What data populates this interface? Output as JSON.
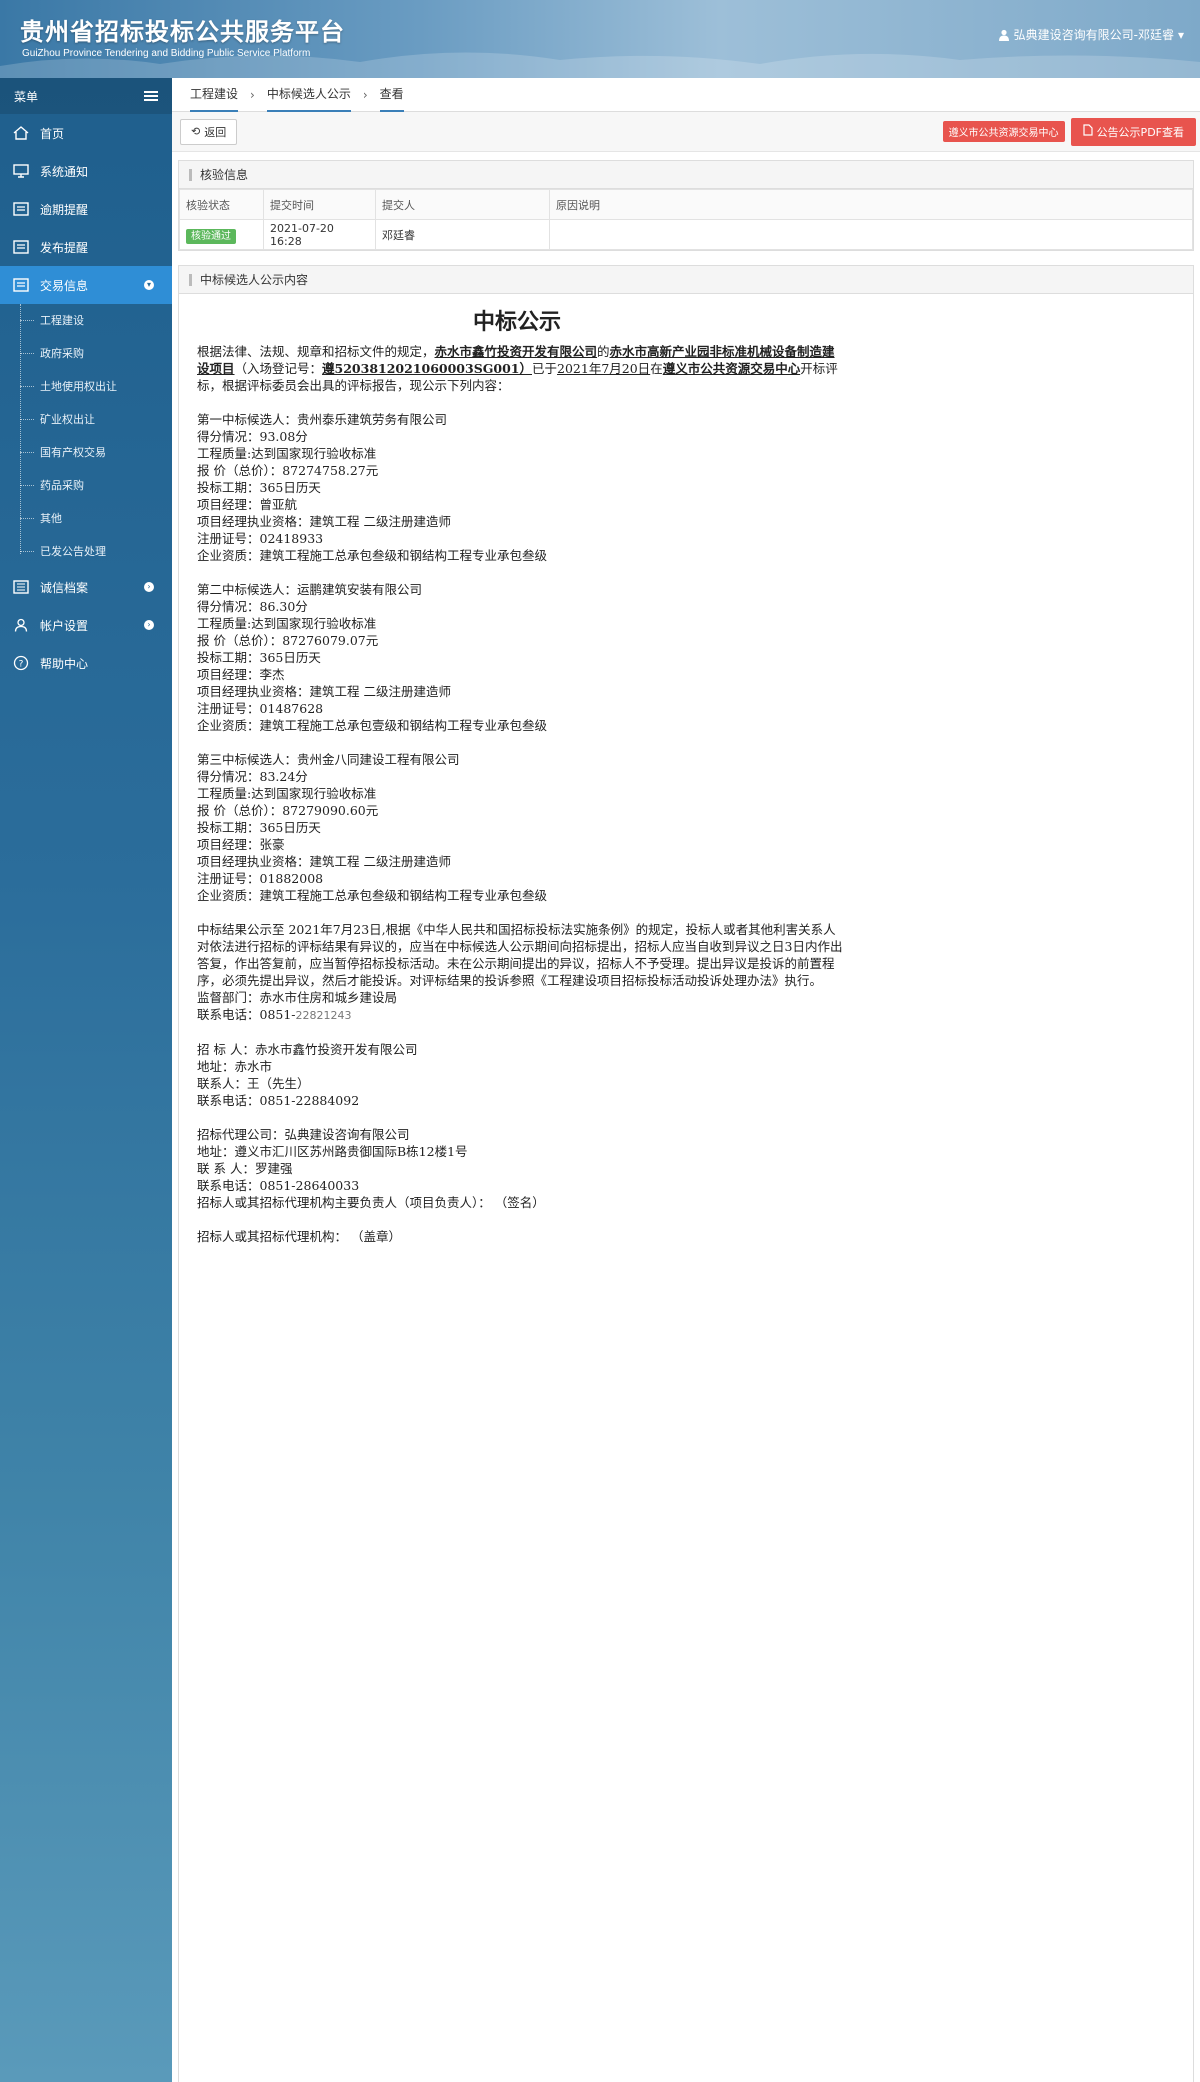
{
  "header": {
    "title": "贵州省招标投标公共服务平台",
    "subtitle": "GuiZhou Province Tendering and Bidding Public Service Platform",
    "user": "弘典建设咨询有限公司-邓廷睿"
  },
  "sidebar": {
    "menu_label": "菜单",
    "items": [
      {
        "label": "首页",
        "icon": "home-icon"
      },
      {
        "label": "系统通知",
        "icon": "monitor-icon"
      },
      {
        "label": "逾期提醒",
        "icon": "doc-icon"
      },
      {
        "label": "发布提醒",
        "icon": "doc-icon"
      },
      {
        "label": "交易信息",
        "icon": "doc-icon"
      }
    ],
    "sub_items": [
      "工程建设",
      "政府采购",
      "土地使用权出让",
      "矿业权出让",
      "国有产权交易",
      "药品采购",
      "其他",
      "已发公告处理"
    ],
    "bottom_items": [
      {
        "label": "诚信档案",
        "icon": "list-icon"
      },
      {
        "label": "帐户设置",
        "icon": "user-icon"
      },
      {
        "label": "帮助中心",
        "icon": "help-icon"
      }
    ]
  },
  "breadcrumb": [
    "工程建设",
    "中标候选人公示",
    "查看"
  ],
  "toolbar": {
    "back_label": "返回",
    "tag_label": "遵义市公共资源交易中心",
    "pdf_label": "公告公示PDF查看"
  },
  "verify": {
    "title": "核验信息",
    "headers": [
      "核验状态",
      "提交时间",
      "提交人",
      "原因说明"
    ],
    "row": {
      "status": "核验通过",
      "time": "2021-07-20 16:28",
      "submitter": "邓廷睿",
      "reason": ""
    }
  },
  "content": {
    "title": "中标候选人公示内容",
    "doc_title": "中标公示",
    "intro": {
      "p1": "根据法律、法规、规章和招标文件的规定，",
      "tenderer": "赤水市鑫竹投资开发有限公司",
      "p2": "的",
      "project": "赤水市高新产业园非标准机械设备制造建设项目",
      "p3": "（入场登记号：",
      "reg_no": "遵5203812021060003SG001）",
      "p4": "已于",
      "date": "2021年7月20日",
      "p5": "在",
      "center": "遵义市公共资源交易中心",
      "p6": "开标评标，根据评标委员会出具的评标报告，现公示下列内容："
    },
    "candidates": [
      {
        "lines": [
          "第一中标候选人：贵州泰乐建筑劳务有限公司",
          "得分情况：93.08分",
          "工程质量:达到国家现行验收标准",
          "报 价（总价）：87274758.27元",
          "投标工期：365日历天",
          "项目经理：曾亚航",
          "项目经理执业资格：建筑工程 二级注册建造师",
          "注册证号：02418933",
          "企业资质：建筑工程施工总承包叁级和钢结构工程专业承包叁级"
        ]
      },
      {
        "lines": [
          "第二中标候选人：运鹏建筑安装有限公司",
          "得分情况：86.30分",
          "工程质量:达到国家现行验收标准",
          "报 价（总价）：87276079.07元",
          "投标工期：365日历天",
          "项目经理：李杰",
          "项目经理执业资格：建筑工程 二级注册建造师",
          "注册证号：01487628",
          "企业资质：建筑工程施工总承包壹级和钢结构工程专业承包叁级"
        ]
      },
      {
        "lines": [
          "第三中标候选人：贵州金八同建设工程有限公司",
          "得分情况：83.24分",
          "工程质量:达到国家现行验收标准",
          "报 价（总价）：87279090.60元",
          "投标工期：365日历天",
          "项目经理：张豪",
          "项目经理执业资格：建筑工程 二级注册建造师",
          "注册证号：01882008",
          "企业资质：建筑工程施工总承包叁级和钢结构工程专业承包叁级"
        ]
      }
    ],
    "notice": "中标结果公示至 2021年7月23日,根据《中华人民共和国招标投标法实施条例》的规定，投标人或者其他利害关系人对依法进行招标的评标结果有异议的，应当在中标候选人公示期间向招标提出，招标人应当自收到异议之日3日内作出答复，作出答复前，应当暂停招标投标活动。未在公示期间提出的异议，招标人不予受理。提出异议是投诉的前置程序，必须先提出异议，然后才能投诉。对评标结果的投诉参照《工程建设项目招标投标活动投诉处理办法》执行。",
    "supervisor": "监督部门：赤水市住房和城乡建设局",
    "supervisor_phone_label": "联系电话：0851-",
    "supervisor_phone": "22821243",
    "tenderer_block": [
      "招 标 人：赤水市鑫竹投资开发有限公司",
      "地址：赤水市",
      "联系人：王（先生）",
      "联系电话：0851-22884092"
    ],
    "agent_block": [
      "招标代理公司：弘典建设咨询有限公司",
      "地址：遵义市汇川区苏州路贵御国际B栋12楼1号",
      "联 系 人：罗建强",
      "联系电话：0851-28640033",
      "招标人或其招标代理机构主要负责人（项目负责人）： （签名）"
    ],
    "seal": "招标人或其招标代理机构： （盖章）"
  }
}
